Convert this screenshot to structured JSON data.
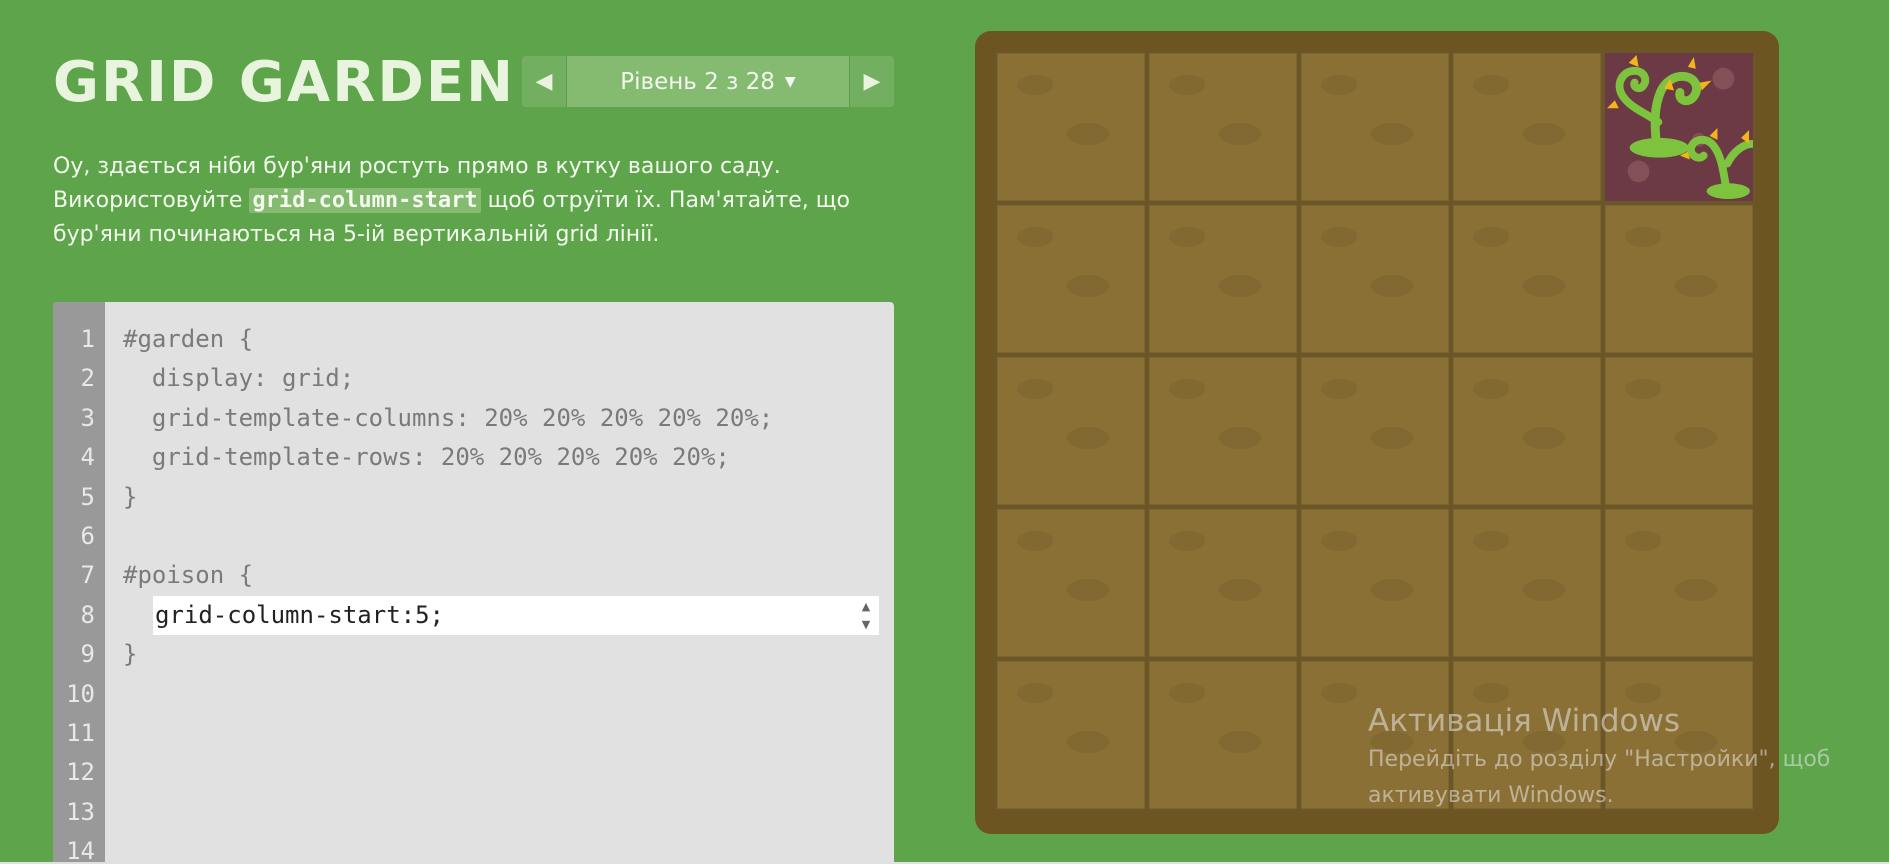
{
  "header": {
    "title": "GRID GARDEN"
  },
  "level_nav": {
    "prev_symbol": "◀",
    "next_symbol": "▶",
    "level_label": "Рівень 2 з 28",
    "caret": "▼"
  },
  "instructions": {
    "part1": "Оу, здається ніби бур'яни ростуть прямо в кутку вашого саду. Використовуйте ",
    "code": "grid-column-start",
    "part2": " щоб отруїти їх. Пам'ятайте, що бур'яни починаються на 5-ій вертикальній grid лінії."
  },
  "editor": {
    "line_numbers": [
      "1",
      "2",
      "3",
      "4",
      "5",
      "6",
      "7",
      "8",
      "9",
      "10",
      "11",
      "12",
      "13",
      "14"
    ],
    "lines": {
      "l1": "#garden {",
      "l2": "  display: grid;",
      "l3": "  grid-template-columns: 20% 20% 20% 20% 20%;",
      "l4": "  grid-template-rows: 20% 20% 20% 20% 20%;",
      "l5": "}",
      "l6": "",
      "l7": "#poison {",
      "l9": "}"
    },
    "input_value": "grid-column-start:5;",
    "spinner_up": "▲",
    "spinner_down": "▼"
  },
  "garden": {
    "columns": 5,
    "rows": 5,
    "weed": {
      "column": 5,
      "row": 1
    }
  },
  "colors": {
    "background": "#5da44a",
    "soil": "#8a7035",
    "frame": "#6c5520",
    "weed_bed": "#6b3a44",
    "weed": "#7dc33e"
  },
  "watermark": {
    "title": "Активація Windows",
    "line1": "Перейдіть до розділу \"Настройки\", щоб",
    "line2": "активувати Windows."
  }
}
